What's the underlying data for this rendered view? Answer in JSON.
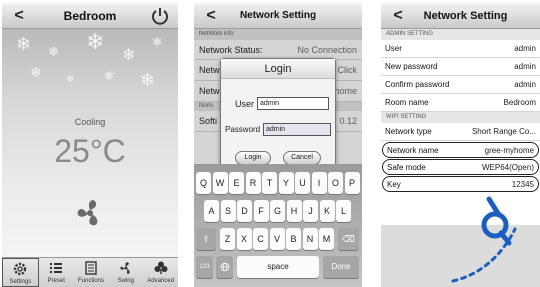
{
  "screen1": {
    "title": "Bedroom",
    "mode": "Cooling",
    "temperature": "25°C",
    "tabs": [
      {
        "label": "Settings",
        "icon": "gear-icon"
      },
      {
        "label": "Preset",
        "icon": "list-icon"
      },
      {
        "label": "Functions",
        "icon": "document-icon"
      },
      {
        "label": "Swing",
        "icon": "fan-icon"
      },
      {
        "label": "Advanced",
        "icon": "clover-icon"
      }
    ]
  },
  "screen2": {
    "title": "Network Setting",
    "section_info": "NetWork info",
    "rows": [
      {
        "label": "Network Status:",
        "value": "No Connection"
      },
      {
        "label": "Netw",
        "value": "Click"
      },
      {
        "label": "Netw",
        "value": "home"
      }
    ],
    "section_name": "Nomi",
    "soft_row": {
      "label": "Softi",
      "value": "0.12"
    },
    "login": {
      "title": "Login",
      "user_label": "User",
      "user_value": "admin",
      "password_label": "Password",
      "password_value": "admin",
      "login_button": "Login",
      "cancel_button": "Cancel"
    },
    "keyboard": {
      "row1": [
        "Q",
        "W",
        "E",
        "R",
        "T",
        "Y",
        "U",
        "I",
        "O",
        "P"
      ],
      "row2": [
        "A",
        "S",
        "D",
        "F",
        "G",
        "H",
        "J",
        "K",
        "L"
      ],
      "row3": [
        "Z",
        "X",
        "C",
        "V",
        "B",
        "N",
        "M"
      ],
      "shift": "⇧",
      "delete": "⌫",
      "numbers": "123",
      "space": "space",
      "done": "Done"
    }
  },
  "screen3": {
    "title": "Network Setting",
    "section_admin": "ADMIN SETTING",
    "admin_rows": [
      {
        "label": "User",
        "value": "admin"
      },
      {
        "label": "New password",
        "value": "admin"
      },
      {
        "label": "Confirm password",
        "value": "admin"
      },
      {
        "label": "Room name",
        "value": "Bedroom"
      }
    ],
    "section_wifi": "WIFI SETTING",
    "wifi_rows": [
      {
        "label": "Network type",
        "value": "Short Range Co..."
      },
      {
        "label": "Network name",
        "value": "gree-myhome"
      },
      {
        "label": "Safe mode",
        "value": "WEP64(Open)"
      },
      {
        "label": "Key",
        "value": "12345"
      }
    ]
  },
  "colors": {
    "watermark": "#1a5fc0"
  }
}
